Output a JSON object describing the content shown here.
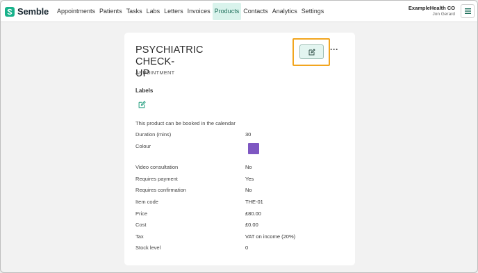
{
  "app": {
    "brand": "Semble",
    "nav": [
      "Appointments",
      "Patients",
      "Tasks",
      "Labs",
      "Letters",
      "Invoices",
      "Products",
      "Contacts",
      "Analytics",
      "Settings"
    ],
    "active_nav": "Products",
    "org_name": "ExampleHealth CO",
    "user_name": "Jon Gerard"
  },
  "product": {
    "title": "PSYCHIATRIC CHECK-UP",
    "title_line1": "PSYCHIATRIC CHECK-",
    "title_line2": "UP",
    "type": "APPOINTMENT",
    "labels_heading": "Labels",
    "bookable_text": "This product can be booked in the calendar",
    "colour_hex": "#7e57c2",
    "fields": [
      {
        "label": "Duration (mins)",
        "value": "30"
      },
      {
        "label": "Colour",
        "value": ""
      },
      {
        "label": "Video consultation",
        "value": "No"
      },
      {
        "label": "Requires payment",
        "value": "Yes"
      },
      {
        "label": "Requires confirmation",
        "value": "No"
      },
      {
        "label": "Item code",
        "value": "THE-01"
      },
      {
        "label": "Price",
        "value": "£80.00"
      },
      {
        "label": "Cost",
        "value": "£0.00"
      },
      {
        "label": "Tax",
        "value": "VAT on income (20%)"
      },
      {
        "label": "Stock level",
        "value": "0"
      }
    ]
  },
  "icons": {
    "logo": "semble-logo-icon",
    "menu": "hamburger-menu-icon",
    "edit": "pencil-edit-icon",
    "more": "more-options-icon"
  },
  "colors": {
    "brand": "#18b28b",
    "active_nav_bg": "#d9f3ec",
    "highlight": "#f2a51e"
  }
}
